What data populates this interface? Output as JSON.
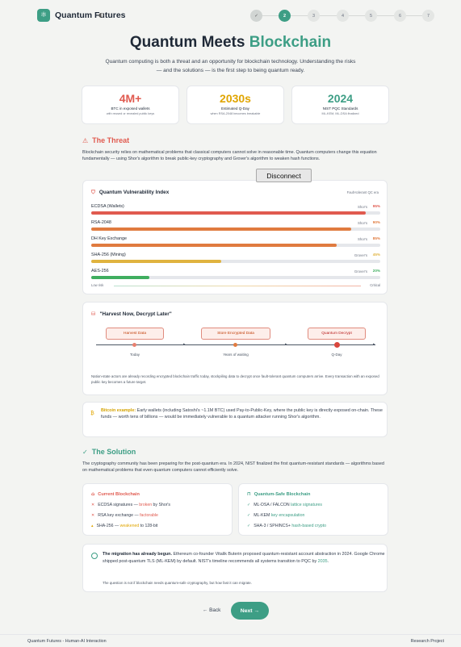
{
  "app": {
    "title": "Quantum Futures",
    "logo_icon": "atom-icon",
    "theme_icon": "half-moon-icon"
  },
  "colors": {
    "accent": "#3d9e85",
    "danger": "#e05a4f",
    "orange": "#e07b3f",
    "amber": "#e0a500",
    "green": "#3fae5f"
  },
  "stepper": {
    "steps": [
      "✓",
      "2",
      "3",
      "4",
      "5",
      "6",
      "7"
    ],
    "current": 2
  },
  "hero": {
    "title_a": "Quantum Meets",
    "title_b": "Blockchain",
    "subtitle": "Quantum computing is both a threat and an opportunity for blockchain technology. Understanding the risks — and the solutions — is the first step to being quantum ready."
  },
  "stats": [
    {
      "value": "4M+",
      "label": "BTC in exposed wallets",
      "note": "with reused or revealed public keys",
      "color": "#e05a4f"
    },
    {
      "value": "2030s",
      "label": "Estimated Q-Day",
      "note": "when RSA-2048 becomes breakable",
      "color": "#e0a500"
    },
    {
      "value": "2024",
      "label": "NIST PQC Standards",
      "note": "ML-KEM, ML-DSA finalized",
      "color": "#3d9e85"
    }
  ],
  "threat": {
    "heading": "The Threat",
    "text": "Blockchain security relies on mathematical problems that classical computers cannot solve in reasonable time. Quantum computers change this equation fundamentally — using Shor's algorithm to break public-key cryptography and Grover's algorithm to weaken hash functions."
  },
  "tooltip": "Disconnect",
  "vuln": {
    "title": "Quantum Vulnerability Index",
    "note": "Fault-tolerant QC era",
    "rows": [
      {
        "name": "ECDSA (Wallets)",
        "algo": "Shor's",
        "pct": "95%",
        "level": 0.95,
        "color": "#e05a4f"
      },
      {
        "name": "RSA-2048",
        "algo": "Shor's",
        "pct": "90%",
        "level": 0.9,
        "color": "#e07b3f"
      },
      {
        "name": "DH Key Exchange",
        "algo": "Shor's",
        "pct": "85%",
        "level": 0.85,
        "color": "#e07b3f"
      },
      {
        "name": "SHA-256 (Mining)",
        "algo": "Grover's",
        "pct": "45%",
        "level": 0.45,
        "color": "#e0b33f"
      },
      {
        "name": "AES-256",
        "algo": "Grover's",
        "pct": "20%",
        "level": 0.2,
        "color": "#3fae5f"
      }
    ],
    "low": "Low risk",
    "high": "Critical"
  },
  "harvest": {
    "title": "\"Harvest Now, Decrypt Later\"",
    "boxes": [
      "Harvest Data",
      "Store Encrypted Data",
      "Quantum Decrypt"
    ],
    "captions": [
      "Today",
      "Years of waiting",
      "Q-Day"
    ],
    "text": "Nation-state actors are already recording encrypted blockchain traffic today, stockpiling data to decrypt once fault-tolerant quantum computers arrive. Every transaction with an exposed public key becomes a future target."
  },
  "bitcoin": {
    "label": "Bitcoin example:",
    "text": " Early wallets (including Satoshi's ~1.1M BTC) used Pay-to-Public-Key, where the public key is directly exposed on-chain. These funds — worth tens of billions — would be immediately vulnerable to a quantum attacker running Shor's algorithm."
  },
  "solution": {
    "heading": "The Solution",
    "text": "The cryptography community has been preparing for the post-quantum era. In 2024, NIST finalized the first quantum-resistant standards — algorithms based on mathematical problems that even quantum computers cannot efficiently solve."
  },
  "current": {
    "title": "Current Blockchain",
    "items": [
      {
        "a": "ECDSA signatures — ",
        "b": "broken",
        "c": " by Shor's"
      },
      {
        "a": "RSA key exchange — ",
        "b": "factorable",
        "c": ""
      },
      {
        "a": "SHA-256 — ",
        "b": "weakened",
        "c": " to 128-bit"
      }
    ]
  },
  "safe": {
    "title": "Quantum-Safe Blockchain",
    "items": [
      {
        "a": "ML-DSA / FALCON ",
        "b": "lattice signatures"
      },
      {
        "a": "ML-KEM ",
        "b": "key encapsulation"
      },
      {
        "a": "SHA-3 / SPHINCS+ ",
        "b": "hash-based crypto"
      }
    ]
  },
  "migration": {
    "bold": "The migration has already begun.",
    "text1": " Ethereum co-founder Vitalik Buterin proposed quantum-resistant account abstraction in 2024. Google Chrome shipped post-quantum TLS (ML-KEM) by default. NIST's timeline recommends all systems transition to PQC by ",
    "year": "2035",
    "text2": ".",
    "question": "The question is not if blockchain needs quantum-safe cryptography, but how fast it can migrate."
  },
  "nav": {
    "back": "← Back",
    "next": "Next →"
  },
  "footer": {
    "left": "Quantum Futures - Human-AI Interaction",
    "right": "Research Project"
  }
}
